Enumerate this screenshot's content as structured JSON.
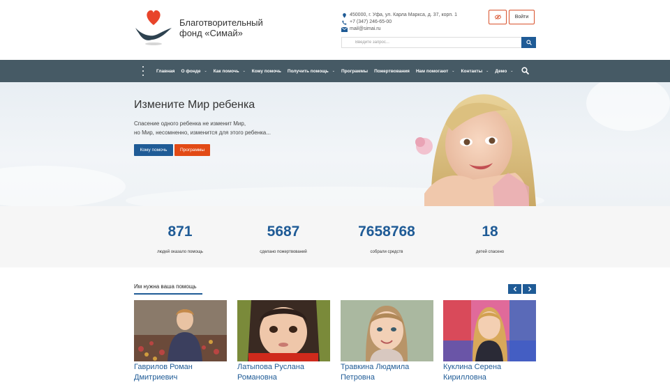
{
  "header": {
    "org_name_line1": "Благотворительный",
    "org_name_line2": "фонд «Симай»",
    "address": "450000, г. Уфа, ул. Карла Маркса, д. 37, корп. 1",
    "phone": "+7 (347) 246-65-00",
    "email": "mail@simai.ru",
    "login_label": "Войти",
    "search_placeholder": "Введите запрос..."
  },
  "nav": {
    "items": [
      {
        "label": "Главная",
        "has_dropdown": false
      },
      {
        "label": "О фонде",
        "has_dropdown": true
      },
      {
        "label": "Как помочь",
        "has_dropdown": true
      },
      {
        "label": "Кому помочь",
        "has_dropdown": false
      },
      {
        "label": "Получить помощь",
        "has_dropdown": true
      },
      {
        "label": "Программы",
        "has_dropdown": false
      },
      {
        "label": "Пожертвования",
        "has_dropdown": false
      },
      {
        "label": "Нам помогают",
        "has_dropdown": true
      },
      {
        "label": "Контакты",
        "has_dropdown": true
      },
      {
        "label": "Демо",
        "has_dropdown": true
      }
    ],
    "caret": "⌄"
  },
  "hero": {
    "title": "Измените Мир ребенка",
    "text_line1": "Спасение одного ребенка не изменит Мир,",
    "text_line2": "но Мир, несомненно, изменится для этого ребенка...",
    "help_button": "Кому помочь",
    "programs_button": "Программы"
  },
  "stats": [
    {
      "value": "871",
      "label": "людей оказало помощь"
    },
    {
      "value": "5687",
      "label": "сделано пожертвований"
    },
    {
      "value": "7658768",
      "label": "собрали средств"
    },
    {
      "value": "18",
      "label": "детей спасено"
    }
  ],
  "children": {
    "title": "Им нужна ваша помощь",
    "cards": [
      {
        "name_line1": "Гаврилов Роман",
        "name_line2": "Дмитриевич"
      },
      {
        "name_line1": "Латыпова Руслана",
        "name_line2": "Романовна"
      },
      {
        "name_line1": "Травкина Людмила",
        "name_line2": "Петровна"
      },
      {
        "name_line1": "Куклина Серена",
        "name_line2": "Кирилловна"
      }
    ]
  },
  "colors": {
    "brand_blue": "#1f5b96",
    "accent_orange": "#e24a15",
    "nav_bg": "#465a65"
  }
}
